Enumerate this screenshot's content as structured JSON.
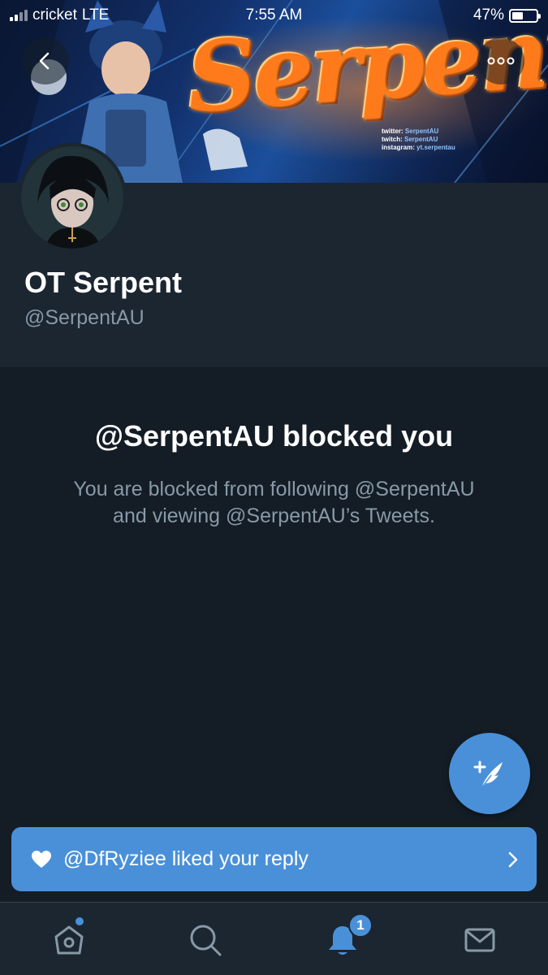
{
  "status_bar": {
    "carrier": "cricket",
    "network": "LTE",
    "time": "7:55 AM",
    "battery": "47%",
    "battery_level": 0.47
  },
  "banner": {
    "word": "Serpent",
    "social": [
      {
        "label": "twitter:",
        "value": "SerpentAU"
      },
      {
        "label": "twitch:",
        "value": "SerpentAU"
      },
      {
        "label": "instagram:",
        "value": "yt.serpentau"
      }
    ]
  },
  "profile": {
    "display_name": "OT Serpent",
    "handle": "@SerpentAU"
  },
  "blocked": {
    "title": "@SerpentAU blocked you",
    "line1": "You are blocked from following @SerpentAU",
    "line2": "and viewing @SerpentAU’s Tweets."
  },
  "toast": {
    "text": "@DfRyziee liked your reply"
  },
  "tab_bar": {
    "notifications_badge": "1"
  },
  "colors": {
    "background": "#141d26",
    "header": "#1b2631",
    "accent": "#4a90d9",
    "secondary_text": "#8899a6"
  },
  "icons": {
    "back": "chevron-left-icon",
    "more": "more-horizontal-icon",
    "compose": "compose-tweet-icon",
    "like": "heart-icon",
    "chevron": "chevron-right-icon",
    "home": "home-icon",
    "search": "search-icon",
    "notifications": "bell-icon",
    "messages": "mail-icon"
  }
}
